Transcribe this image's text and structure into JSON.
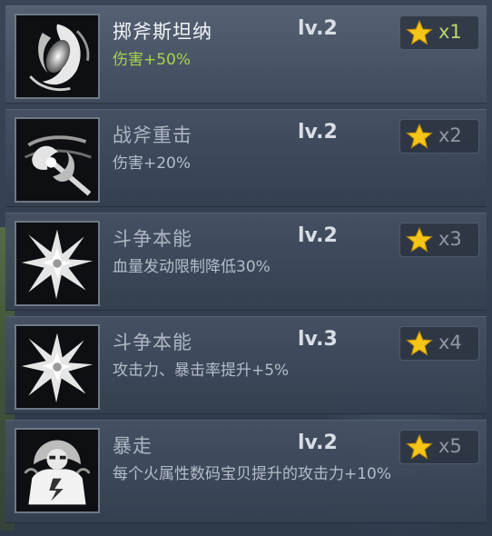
{
  "skills": [
    {
      "name": "掷斧斯坦纳",
      "level": "lv.2",
      "desc": "伤害+50%",
      "star_count": "x1",
      "icon": "spinning-axe-icon"
    },
    {
      "name": "战斧重击",
      "level": "lv.2",
      "desc": "伤害+20%",
      "star_count": "x2",
      "icon": "battle-axe-icon"
    },
    {
      "name": "斗争本能",
      "level": "lv.2",
      "desc": "血量发动限制降低30%",
      "star_count": "x3",
      "icon": "burst-icon"
    },
    {
      "name": "斗争本能",
      "level": "lv.3",
      "desc": "攻击力、暴击率提升+5%",
      "star_count": "x4",
      "icon": "burst-icon"
    },
    {
      "name": "暴走",
      "level": "lv.2",
      "desc": "每个火属性数码宝贝提升的攻击力+10%",
      "star_count": "x5",
      "icon": "berserk-icon"
    }
  ],
  "colors": {
    "highlight_desc": "#a6d44a",
    "star": "#f5c518"
  }
}
